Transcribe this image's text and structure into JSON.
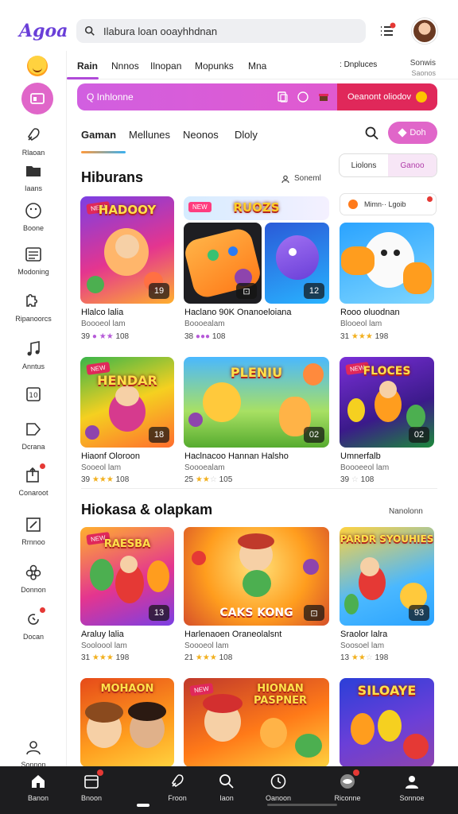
{
  "app": {
    "logo": "Agoa",
    "search_placeholder": "Ilabura loan ooayhhdnan"
  },
  "rail": {
    "items": [
      {
        "label": "Rlaoan",
        "icon": "rocket-icon"
      },
      {
        "label": "Iaans",
        "icon": "folder-icon"
      },
      {
        "label": "Boone",
        "icon": "smile-icon"
      },
      {
        "label": "Modoning",
        "icon": "list-icon"
      },
      {
        "label": "Ripanoorcs",
        "icon": "puzzle-icon"
      },
      {
        "label": "Anntus",
        "icon": "music-icon"
      },
      {
        "label": "",
        "icon": "media-icon"
      },
      {
        "label": "Dcrana",
        "icon": "tag-icon"
      },
      {
        "label": "Conaroot",
        "icon": "share-icon"
      },
      {
        "label": "Rrnnoo",
        "icon": "edit-icon"
      },
      {
        "label": "Donnon",
        "icon": "flower-icon"
      },
      {
        "label": "Docan",
        "icon": "refresh-icon"
      },
      {
        "label": "Sonnon",
        "icon": "user-icon"
      }
    ]
  },
  "categories": {
    "items": [
      "Rain",
      "Nnnos",
      "Ilnopan",
      "Mopunks",
      "Mna"
    ],
    "right_title": "Dnpluces",
    "right_block_title": "Sonwis",
    "right_block_sub": "Saonos"
  },
  "promo": {
    "query": "Inhlonne",
    "button_label": "Oeanont oliodov"
  },
  "tabs": {
    "items": [
      "Gaman",
      "Mellunes",
      "Neonos",
      "Dloly"
    ],
    "pill_label": "Doh"
  },
  "section1": {
    "title": "Hiburans",
    "link": "Soneml",
    "segment": [
      "Liolons",
      "Ganoo"
    ],
    "notice": "Mimn·· Lgoib"
  },
  "section2": {
    "title": "Hiokasa & olapkam",
    "link": "Nanolonn"
  },
  "games": [
    {
      "thumb_title": "HADOOY",
      "thumb_tag": "NEW",
      "num": "19",
      "title": "Hlalco lalia",
      "sub": "Boooeol lam",
      "rating": "39",
      "stars": 0,
      "extra": "108"
    },
    {
      "thumb_title": "RUOZS",
      "thumb_tag": "",
      "num": "",
      "title": "Haclano 90K Onanoeloiana",
      "sub": "Boooealam",
      "rating": "38",
      "stars": 0,
      "extra": "108"
    },
    {
      "thumb_title": "",
      "thumb_tag": "",
      "num": "12",
      "title": "",
      "sub": "",
      "rating": "",
      "stars": 0,
      "extra": ""
    },
    {
      "thumb_title": "",
      "thumb_tag": "",
      "num": "",
      "title": "Rooo oluodnan",
      "sub": "Blooeol lam",
      "rating": "31",
      "stars": 3,
      "extra": "198"
    },
    {
      "thumb_title": "HENDAR",
      "thumb_tag": "NEW",
      "num": "18",
      "title": "Hiaonf Oloroon",
      "sub": "Sooeol lam",
      "rating": "39",
      "stars": 3,
      "extra": "108"
    },
    {
      "thumb_title": "PLENIU",
      "thumb_tag": "",
      "num": "02",
      "title": "Haclnacoo Hannan Halsho",
      "sub": "Soooealam",
      "rating": "25",
      "stars": 2,
      "extra": "105"
    },
    {
      "thumb_title": "FLOCES",
      "thumb_tag": "NEW",
      "num": "02",
      "title": "Umnerfalb",
      "sub": "Boooeeol lam",
      "rating": "39",
      "stars": 0,
      "extra": "108"
    },
    {
      "thumb_title": "RAESBA",
      "thumb_tag": "NEW",
      "num": "13",
      "title": "Araluy lalia",
      "sub": "Sooloool lam",
      "rating": "31",
      "stars": 3,
      "extra": "198"
    },
    {
      "thumb_title": "CAKS KONG",
      "thumb_tag": "",
      "num": "",
      "title": "Harlenaoen Oraneolalsnt",
      "sub": "Soooeol lam",
      "rating": "21",
      "stars": 3,
      "extra": "108"
    },
    {
      "thumb_title": "PARDR SYOUHIES",
      "thumb_tag": "",
      "num": "93",
      "title": "Sraolor lalra",
      "sub": "Soosoel lam",
      "rating": "13",
      "stars": 2,
      "extra": "198"
    },
    {
      "thumb_title": "MOHAON",
      "thumb_tag": "",
      "num": "",
      "title": "",
      "sub": "",
      "rating": "",
      "stars": 0,
      "extra": ""
    },
    {
      "thumb_title": "HIONAN PASPNER",
      "thumb_tag": "NEW",
      "num": "",
      "title": "",
      "sub": "",
      "rating": "",
      "stars": 0,
      "extra": ""
    },
    {
      "thumb_title": "SILOAYE",
      "thumb_tag": "",
      "num": "",
      "title": "",
      "sub": "",
      "rating": "",
      "stars": 0,
      "extra": ""
    }
  ],
  "bottomnav": {
    "items": [
      {
        "label": "Banon",
        "icon": "home-icon"
      },
      {
        "label": "Bnoon",
        "icon": "cards-icon"
      },
      {
        "label": "Froon",
        "icon": "rocket-icon"
      },
      {
        "label": "Iaon",
        "icon": "search-icon"
      },
      {
        "label": "Oanoon",
        "icon": "clock-icon"
      },
      {
        "label": "Riconne",
        "icon": "gamepad-icon"
      },
      {
        "label": "Sonnoe",
        "icon": "profile-icon"
      }
    ]
  },
  "colors": {
    "accent": "#e066c9",
    "promo_button": "#e0285a",
    "nav_bg": "#1d1d1f",
    "star": "#f2b01e"
  }
}
